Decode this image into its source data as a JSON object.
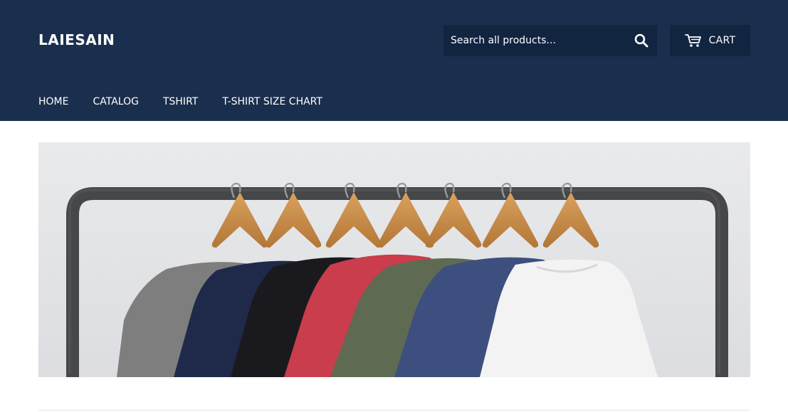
{
  "header": {
    "background_color": "#1a2e4d",
    "logo": "LAIESAIN",
    "search": {
      "placeholder": "Search all products...",
      "icon": "search-icon"
    },
    "cart": {
      "label": "CART",
      "icon": "cart-icon"
    }
  },
  "nav": {
    "items": [
      {
        "label": "HOME"
      },
      {
        "label": "CATALOG"
      },
      {
        "label": "TSHIRT"
      },
      {
        "label": "T-SHIRT SIZE CHART"
      }
    ]
  },
  "hero": {
    "image": "t-shirts-on-clothing-rack",
    "shirt_colors": [
      "#7e7e7e",
      "#1f2a4a",
      "#1a1a1e",
      "#c93d4c",
      "#5e6b52",
      "#3d4f7e",
      "#f3f3f3"
    ]
  }
}
